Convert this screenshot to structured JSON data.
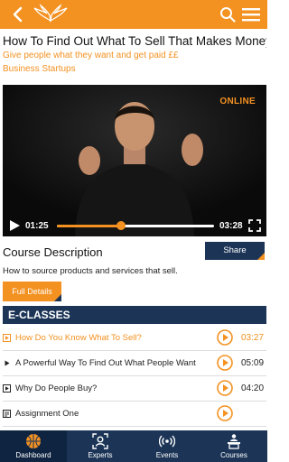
{
  "header": {
    "back_icon": "chevron-left-icon",
    "logo_icon": "wings-logo",
    "search_icon": "search-icon",
    "menu_icon": "hamburger-menu-icon",
    "bg_color": "#f39121"
  },
  "course": {
    "title": "How To Find Out What To Sell That Makes Money",
    "subtitle": "Give people what they want and get paid ££",
    "category": "Business Startups"
  },
  "video": {
    "status": "ONLINE",
    "current_time": "01:25",
    "duration": "03:28",
    "progress": 0.41,
    "buffered": 0.5
  },
  "description": {
    "heading": "Course Description",
    "share_label": "Share",
    "text": "How to source products and services that sell.",
    "full_details_label": "Full Details"
  },
  "eclasses": {
    "heading": "E-CLASSES",
    "items": [
      {
        "label": "How Do You Know What To Sell?",
        "duration": "03:27",
        "active": true,
        "icon": "play-square-icon"
      },
      {
        "label": "A Powerful Way To Find Out What People Want",
        "duration": "05:09",
        "active": false,
        "icon": "play-square-icon"
      },
      {
        "label": "Why Do People Buy?",
        "duration": "04:20",
        "active": false,
        "icon": "play-square-icon"
      },
      {
        "label": "Assignment One",
        "duration": "",
        "active": false,
        "icon": "document-icon"
      }
    ]
  },
  "bottom_nav": {
    "items": [
      {
        "label": "Dashboard",
        "icon": "basketball-icon",
        "active": true
      },
      {
        "label": "Experts",
        "icon": "expert-user-icon",
        "active": false
      },
      {
        "label": "Events",
        "icon": "broadcast-icon",
        "active": false
      },
      {
        "label": "Courses",
        "icon": "podium-icon",
        "active": false
      }
    ]
  },
  "colors": {
    "accent": "#f39121",
    "navy": "#1c3557"
  }
}
